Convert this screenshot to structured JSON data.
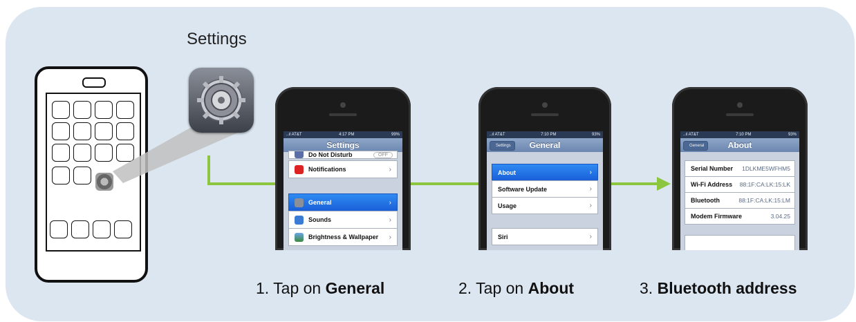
{
  "title": "Settings",
  "steps": [
    {
      "num": "1.",
      "text": "Tap on",
      "strong": "General"
    },
    {
      "num": "2.",
      "text": "Tap on",
      "strong": "About"
    },
    {
      "num": "3.",
      "text": "",
      "strong": "Bluetooth address"
    }
  ],
  "screen1": {
    "status": {
      "carrier": "..ıl AT&T",
      "time": "4:17 PM",
      "battery": "99%"
    },
    "nav_title": "Settings",
    "rows": [
      {
        "label": "Do Not Disturb",
        "toggle": "OFF"
      },
      {
        "label": "Notifications"
      },
      {
        "label": "General",
        "selected": true
      },
      {
        "label": "Sounds"
      },
      {
        "label": "Brightness & Wallpaper"
      }
    ]
  },
  "screen2": {
    "status": {
      "carrier": "..ıl AT&T",
      "time": "7:10 PM",
      "battery": "93%"
    },
    "back": "Settings",
    "nav_title": "General",
    "rows": [
      {
        "label": "About",
        "selected": true
      },
      {
        "label": "Software Update"
      },
      {
        "label": "Usage"
      },
      {
        "label": "Siri"
      }
    ]
  },
  "screen3": {
    "status": {
      "carrier": "..ıl AT&T",
      "time": "7:10 PM",
      "battery": "93%"
    },
    "back": "General",
    "nav_title": "About",
    "rows": [
      {
        "label": "Serial Number",
        "value": "1DLKME5WFHM5"
      },
      {
        "label": "Wi-Fi Address",
        "value": "88:1F:CA:LK:15:LK"
      },
      {
        "label": "Bluetooth",
        "value": "88:1F:CA:LK:15:LM"
      },
      {
        "label": "Modem Firmware",
        "value": "3.04.25"
      }
    ]
  },
  "colors": {
    "arrow": "#8cc63f",
    "panel": "#dce6f1",
    "selected": "#1a5fd8"
  }
}
